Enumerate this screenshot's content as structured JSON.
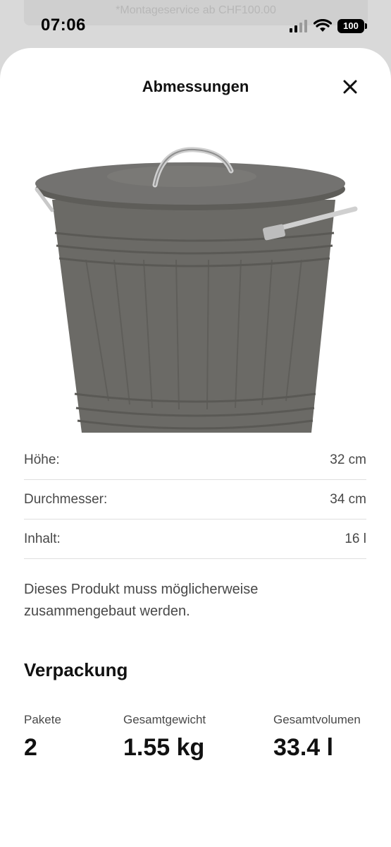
{
  "status_bar": {
    "time": "07:06",
    "battery": "100",
    "background_banner": "*Montageservice ab CHF100.00"
  },
  "sheet": {
    "title": "Abmessungen",
    "close_icon": "close-icon"
  },
  "product_image": {
    "description": "grey metal bin with lid"
  },
  "dimensions": [
    {
      "label": "Höhe:",
      "value": "32 cm"
    },
    {
      "label": "Durchmesser:",
      "value": "34 cm"
    },
    {
      "label": "Inhalt:",
      "value": "16 l"
    }
  ],
  "assembly_note": "Dieses Produkt muss möglicherweise zusammengebaut werden.",
  "packaging": {
    "title": "Verpackung",
    "items": [
      {
        "label": "Pakete",
        "value": "2"
      },
      {
        "label": "Gesamtgewicht",
        "value": "1.55 kg"
      },
      {
        "label": "Gesamtvolumen",
        "value": "33.4 l"
      }
    ]
  },
  "colors": {
    "bin": "#6b6a66",
    "handle": "#c8c8c8",
    "text": "#484848",
    "divider": "#dfdfdf"
  }
}
